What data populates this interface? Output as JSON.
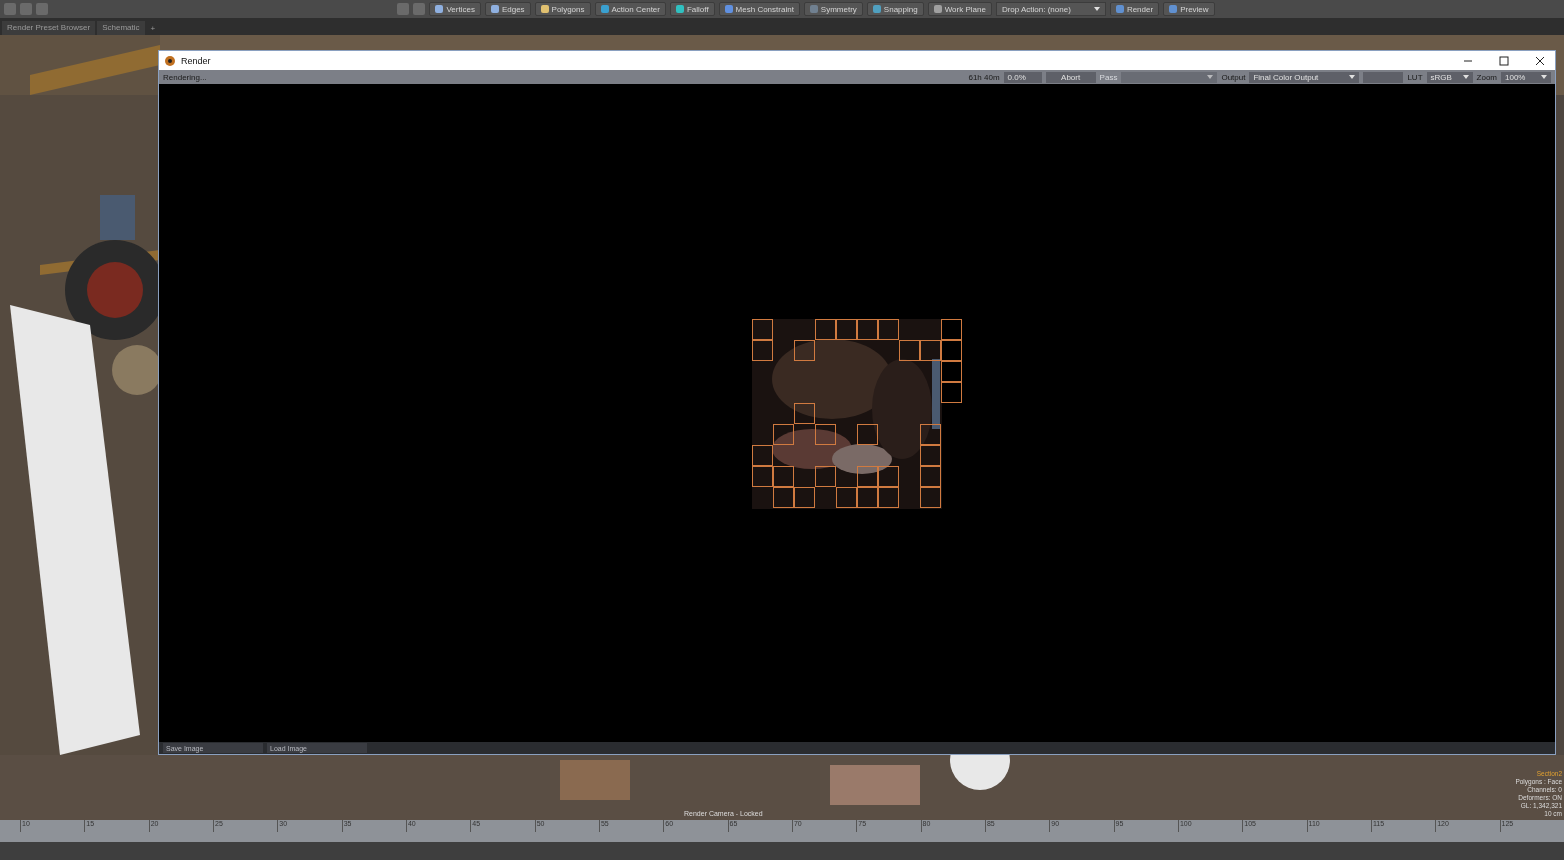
{
  "toolbar": {
    "tools": [
      {
        "label": "Vertices"
      },
      {
        "label": "Edges"
      },
      {
        "label": "Polygons"
      },
      {
        "label": "Action Center"
      },
      {
        "label": "Falloff"
      },
      {
        "label": "Mesh Constraint"
      },
      {
        "label": "Symmetry"
      },
      {
        "label": "Snapping"
      },
      {
        "label": "Work Plane"
      }
    ],
    "drop_action": "Drop Action: (none)",
    "render": "Render",
    "preview": "Preview"
  },
  "tabs": [
    {
      "label": "Render Preset Browser"
    },
    {
      "label": "Schematic"
    }
  ],
  "add_tab": "+",
  "render_window": {
    "title": "Render",
    "status": "Rendering...",
    "time": "61h 40m",
    "progress": "0.0%",
    "abort": "Abort",
    "pass": {
      "label": "Pass",
      "disabled": true
    },
    "output_label": "Output",
    "output_value": "Final Color Output",
    "lut_label": "LUT",
    "lut_value": "sRGB",
    "zoom_label": "Zoom",
    "zoom_value": "100%",
    "footer_buttons": [
      "Save Image",
      "Load Image"
    ]
  },
  "viewport": {
    "camera_label": "Render Camera - Locked",
    "info": [
      "Section2",
      "Polygons : Face",
      "Channels: 0",
      "Deformers: ON",
      "GL: 1,342,321",
      "10 cm"
    ]
  },
  "ruler": [
    "10",
    "15",
    "20",
    "25",
    "30",
    "35",
    "40",
    "45",
    "50",
    "55",
    "60",
    "65",
    "70",
    "75",
    "80",
    "85",
    "90",
    "95",
    "100",
    "105",
    "110",
    "115",
    "120",
    "125"
  ]
}
